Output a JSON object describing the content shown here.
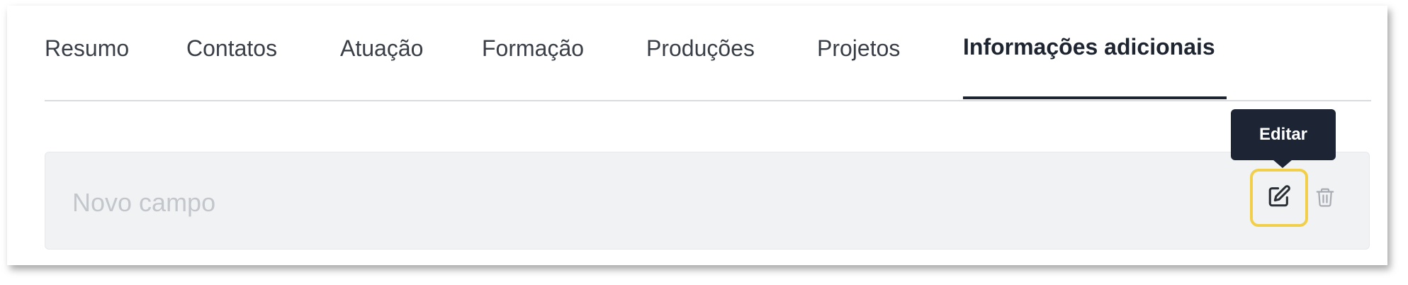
{
  "tabs": [
    {
      "label": "Resumo",
      "active": false
    },
    {
      "label": "Contatos",
      "active": false
    },
    {
      "label": "Atuação",
      "active": false
    },
    {
      "label": "Formação",
      "active": false
    },
    {
      "label": "Produções",
      "active": false
    },
    {
      "label": "Projetos",
      "active": false
    },
    {
      "label": "Informações adicionais",
      "active": true
    }
  ],
  "field": {
    "value": "Novo campo"
  },
  "tooltip": {
    "text": "Editar"
  },
  "actions": {
    "edit_icon": "edit-icon",
    "delete_icon": "trash-icon"
  },
  "colors": {
    "highlight": "#f1cf4a",
    "tooltip_bg": "#1d2434",
    "field_bg": "#f1f2f4",
    "active_tab": "#1f2530"
  }
}
